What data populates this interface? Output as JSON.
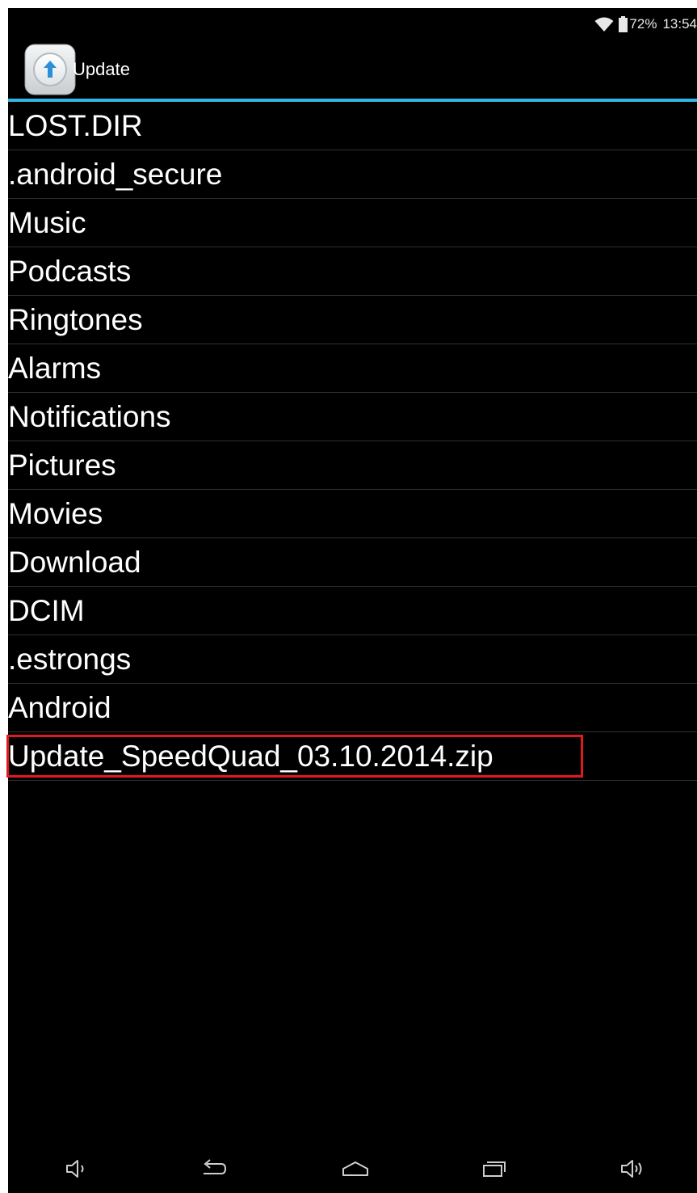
{
  "status_bar": {
    "battery_percent": "72%",
    "clock": "13:54",
    "icons": [
      "wifi-icon",
      "battery-icon"
    ]
  },
  "action_bar": {
    "title": "Update",
    "app_icon": "upload-arrow-icon"
  },
  "file_list": {
    "items": [
      {
        "name": "LOST.DIR"
      },
      {
        "name": ".android_secure"
      },
      {
        "name": "Music"
      },
      {
        "name": "Podcasts"
      },
      {
        "name": "Ringtones"
      },
      {
        "name": "Alarms"
      },
      {
        "name": "Notifications"
      },
      {
        "name": "Pictures"
      },
      {
        "name": "Movies"
      },
      {
        "name": "Download"
      },
      {
        "name": "DCIM"
      },
      {
        "name": ".estrongs"
      },
      {
        "name": "Android"
      },
      {
        "name": "Update_SpeedQuad_03.10.2014.zip",
        "highlighted": true
      }
    ]
  },
  "nav_bar": {
    "buttons": [
      "volume-down-icon",
      "back-icon",
      "home-icon",
      "recent-apps-icon",
      "volume-up-icon"
    ]
  },
  "colors": {
    "background": "#000000",
    "accent": "#33b5e5",
    "highlight": "#e0191e",
    "text": "#ffffff"
  }
}
